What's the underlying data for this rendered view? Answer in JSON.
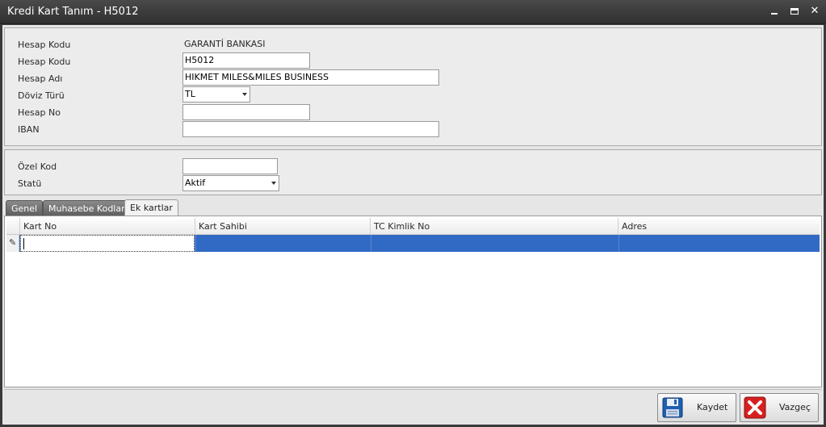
{
  "window": {
    "title": "Kredi Kart Tanım - H5012"
  },
  "form": {
    "hesap_kodu_label_1": "Hesap Kodu",
    "bank_name": "GARANTİ BANKASI",
    "hesap_kodu_label_2": "Hesap Kodu",
    "hesap_kodu_value": "H5012",
    "hesap_adi_label": "Hesap Adı",
    "hesap_adi_value": "HIKMET MILES&MILES BUSINESS",
    "doviz_turu_label": "Döviz Türü",
    "doviz_turu_value": "TL",
    "hesap_no_label": "Hesap No",
    "hesap_no_value": "",
    "iban_label": "IBAN",
    "iban_value": "",
    "ozel_kod_label": "Özel Kod",
    "ozel_kod_value": "",
    "statu_label": "Statü",
    "statu_value": "Aktif"
  },
  "tabs": [
    {
      "label": "Genel",
      "active": false
    },
    {
      "label": "Muhasebe Kodları",
      "active": false
    },
    {
      "label": "Ek kartlar",
      "active": true
    }
  ],
  "grid": {
    "columns": [
      "Kart No",
      "Kart Sahibi",
      "TC Kimlik No",
      "Adres"
    ],
    "rows": [
      [
        "",
        "",
        "",
        ""
      ]
    ],
    "selection_color": "#316ac5"
  },
  "buttons": {
    "save_label": "Kaydet",
    "cancel_label": "Vazgeç"
  },
  "icons": {
    "save": "floppy-disk-icon",
    "cancel": "red-x-icon",
    "row_indicator": "pencil-icon"
  }
}
